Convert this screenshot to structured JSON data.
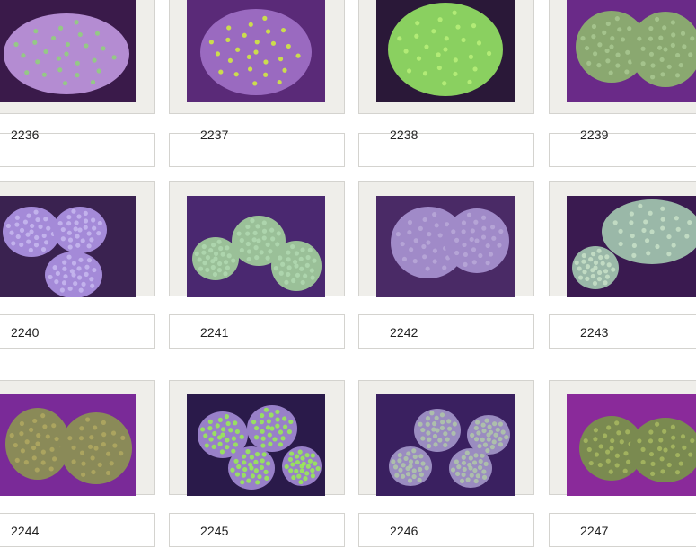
{
  "grid": {
    "items": [
      {
        "label": "2236",
        "bg": "#3a1a4a",
        "tint": "#b48cd2",
        "accent": "#8fd27a"
      },
      {
        "label": "2237",
        "bg": "#5a2a78",
        "tint": "#9a6ac0",
        "accent": "#d4f03a"
      },
      {
        "label": "2238",
        "bg": "#2a1838",
        "tint": "#8ad060",
        "accent": "#b8f07a"
      },
      {
        "label": "2239",
        "bg": "#6a2a88",
        "tint": "#8aa870",
        "accent": "#a8c890"
      },
      {
        "label": "2240",
        "bg": "#3a2250",
        "tint": "#a48ad8",
        "accent": "#c8b8f0"
      },
      {
        "label": "2241",
        "bg": "#4a2870",
        "tint": "#9ac098",
        "accent": "#b0d8b0"
      },
      {
        "label": "2242",
        "bg": "#4a2a66",
        "tint": "#a08ac8",
        "accent": "#b8a8d8"
      },
      {
        "label": "2243",
        "bg": "#3a1a50",
        "tint": "#9ab8a8",
        "accent": "#c8e0c8"
      },
      {
        "label": "2244",
        "bg": "#7a2a98",
        "tint": "#8a8a58",
        "accent": "#b0a860"
      },
      {
        "label": "2245",
        "bg": "#2a1a4a",
        "tint": "#9880c8",
        "accent": "#98f050"
      },
      {
        "label": "2246",
        "bg": "#3a2060",
        "tint": "#9a8cc0",
        "accent": "#b0c8a8"
      },
      {
        "label": "2247",
        "bg": "#8a2a9a",
        "tint": "#7a8a50",
        "accent": "#a8b860"
      }
    ]
  }
}
